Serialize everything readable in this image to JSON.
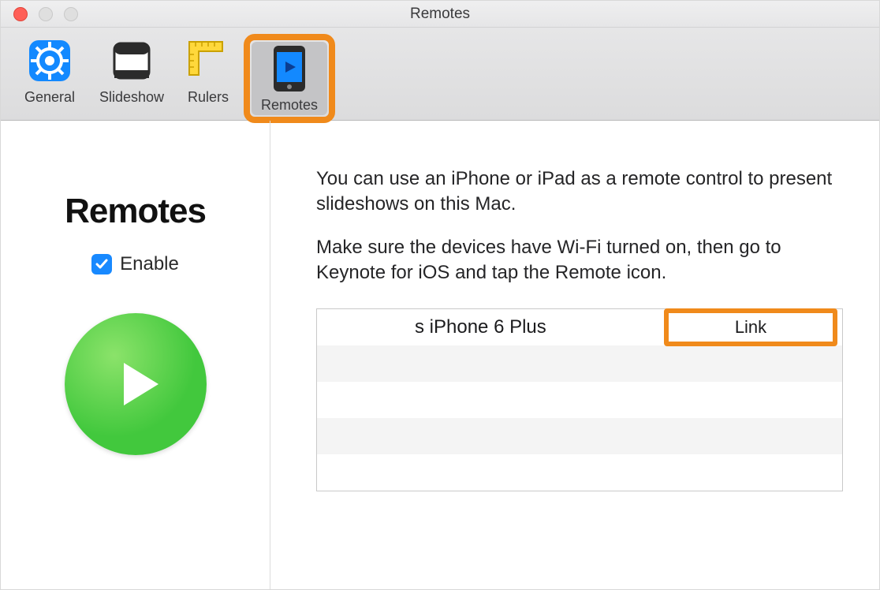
{
  "window": {
    "title": "Remotes"
  },
  "toolbar": {
    "items": [
      {
        "label": "General"
      },
      {
        "label": "Slideshow"
      },
      {
        "label": "Rulers"
      },
      {
        "label": "Remotes"
      }
    ]
  },
  "sidebar": {
    "heading": "Remotes",
    "enable_label": "Enable",
    "enable_checked": true
  },
  "main": {
    "paragraph1": "You can use an iPhone or iPad as a remote control to present slideshows on this Mac.",
    "paragraph2": "Make sure the devices have Wi-Fi turned on, then go to Keynote for iOS and tap the Remote icon.",
    "devices": [
      {
        "name": "s iPhone 6 Plus",
        "link_label": "Link"
      }
    ]
  },
  "colors": {
    "highlight": "#f08a1b",
    "accent_blue": "#1889ff",
    "play_green": "#42c83d"
  }
}
